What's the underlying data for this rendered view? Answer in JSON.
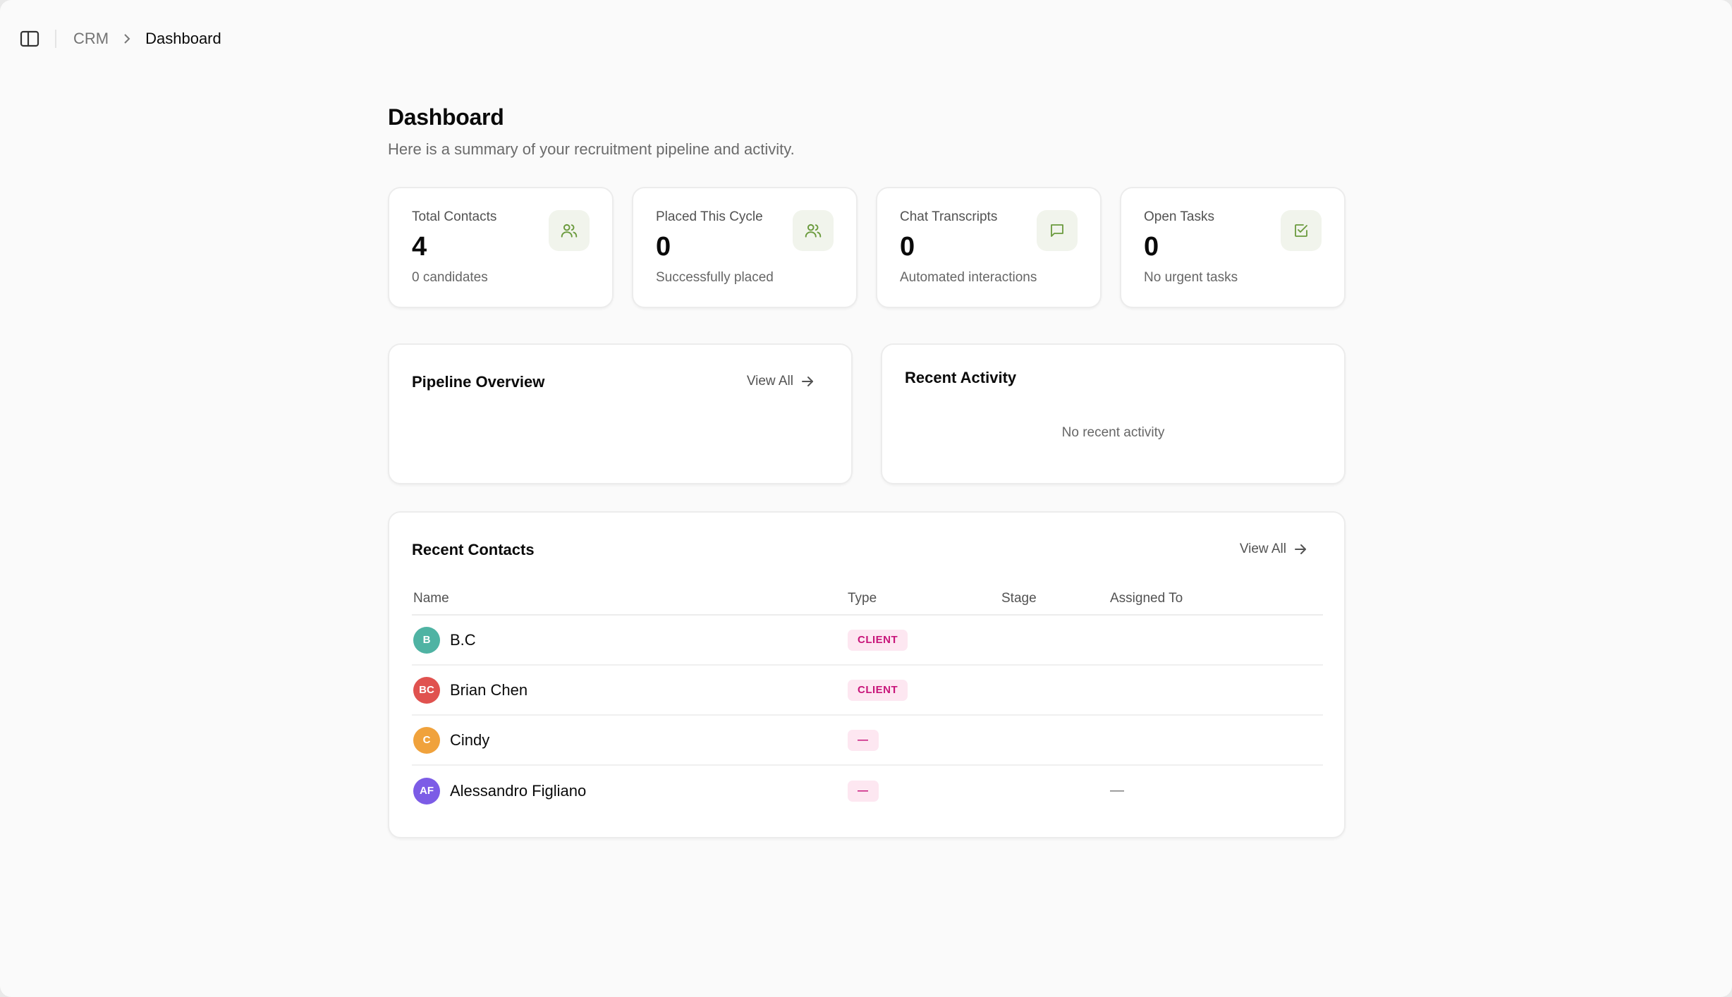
{
  "breadcrumb": {
    "root": "CRM",
    "current": "Dashboard"
  },
  "page": {
    "title": "Dashboard",
    "subtitle": "Here is a summary of your recruitment pipeline and activity."
  },
  "stats": [
    {
      "label": "Total Contacts",
      "value": "4",
      "desc": "0 candidates",
      "icon": "users-icon"
    },
    {
      "label": "Placed This Cycle",
      "value": "0",
      "desc": "Successfully placed",
      "icon": "users-icon"
    },
    {
      "label": "Chat Transcripts",
      "value": "0",
      "desc": "Automated interactions",
      "icon": "message-square-icon"
    },
    {
      "label": "Open Tasks",
      "value": "0",
      "desc": "No urgent tasks",
      "icon": "check-square-icon"
    }
  ],
  "pipeline": {
    "title": "Pipeline Overview",
    "view_all": "View All"
  },
  "activity": {
    "title": "Recent Activity",
    "empty": "No recent activity"
  },
  "contacts": {
    "title": "Recent Contacts",
    "view_all": "View All",
    "columns": {
      "name": "Name",
      "type": "Type",
      "stage": "Stage",
      "assigned": "Assigned To"
    },
    "rows": [
      {
        "initials": "B",
        "name": "B.C",
        "type": "CLIENT",
        "stage": "",
        "assigned": "",
        "color": "#4fb3a3"
      },
      {
        "initials": "BC",
        "name": "Brian Chen",
        "type": "CLIENT",
        "stage": "",
        "assigned": "",
        "color": "#e0524f"
      },
      {
        "initials": "C",
        "name": "Cindy",
        "type": "—",
        "stage": "",
        "assigned": "",
        "color": "#f0a23c"
      },
      {
        "initials": "AF",
        "name": "Alessandro Figliano",
        "type": "—",
        "stage": "",
        "assigned": "—",
        "color": "#7c5ce6"
      }
    ]
  },
  "colors": {
    "accent_green": "#6a9a3c",
    "badge_bg": "#fde7f1",
    "badge_text": "#c8157a"
  }
}
